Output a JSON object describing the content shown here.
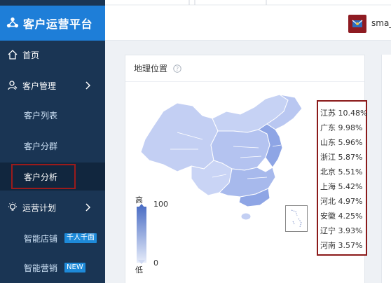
{
  "brand": {
    "title": "客户运营平台"
  },
  "sidebar": {
    "home": "首页",
    "customer_mgmt": "客户管理",
    "customer_list": "客户列表",
    "customer_group": "客户分群",
    "customer_analysis": "客户分析",
    "ops_plan": "运营计划",
    "smart_store": "智能店铺",
    "smart_store_badge": "千人千面",
    "smart_marketing": "智能营销",
    "smart_marketing_badge": "NEW"
  },
  "header": {
    "username": "sma_"
  },
  "panel": {
    "title": "地理位置",
    "legend_high": "高",
    "legend_low": "低",
    "legend_max": "100",
    "legend_min": "0"
  },
  "ranking": [
    {
      "text": "江苏 10.48%"
    },
    {
      "text": "广东 9.98%"
    },
    {
      "text": "山东 5.96%"
    },
    {
      "text": "浙江 5.87%"
    },
    {
      "text": "北京 5.51%"
    },
    {
      "text": "上海 5.42%"
    },
    {
      "text": "河北 4.97%"
    },
    {
      "text": "安徽 4.25%"
    },
    {
      "text": "辽宁 3.93%"
    },
    {
      "text": "河南 3.57%"
    }
  ],
  "colors": {
    "sidebar_bg": "#1a3554",
    "brand_bg": "#1e7ed8",
    "highlight_border": "#8b1a1a",
    "map_fill": "#c3cff3",
    "map_fill_dark": "#7d96df"
  }
}
